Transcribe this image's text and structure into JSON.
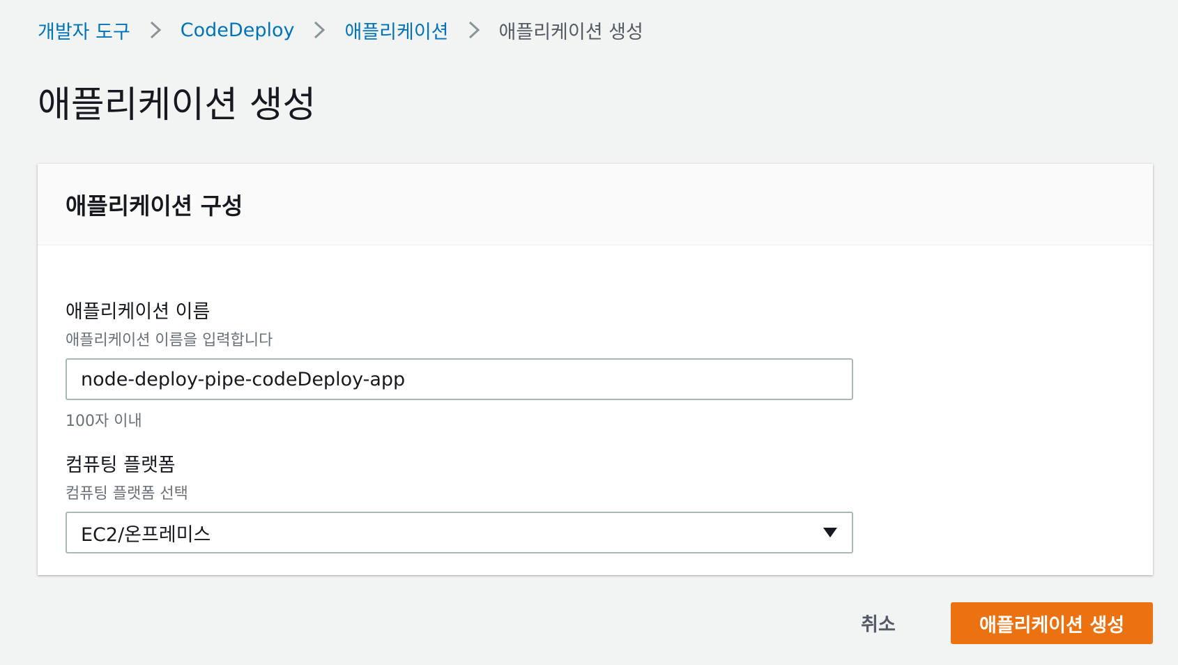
{
  "breadcrumb": {
    "items": [
      {
        "label": "개발자 도구"
      },
      {
        "label": "CodeDeploy"
      },
      {
        "label": "애플리케이션"
      },
      {
        "label": "애플리케이션 생성"
      }
    ]
  },
  "page": {
    "title": "애플리케이션 생성"
  },
  "panel": {
    "title": "애플리케이션 구성",
    "app_name": {
      "label": "애플리케이션 이름",
      "description": "애플리케이션 이름을 입력합니다",
      "value": "node-deploy-pipe-codeDeploy-app",
      "constraint": "100자 이내"
    },
    "platform": {
      "label": "컴퓨팅 플랫폼",
      "description": "컴퓨팅 플랫폼 선택",
      "selected": "EC2/온프레미스",
      "icon": "caret-down-icon"
    }
  },
  "actions": {
    "cancel_label": "취소",
    "submit_label": "애플리케이션 생성"
  },
  "colors": {
    "link": "#0073bb",
    "primary": "#ec7211",
    "background": "#f2f3f3"
  }
}
